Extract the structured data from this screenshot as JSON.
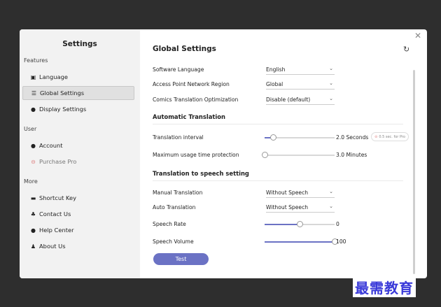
{
  "window": {
    "close_icon": "close-icon"
  },
  "sidebar": {
    "title": "Settings",
    "sections": [
      {
        "label": "Features",
        "items": [
          {
            "label": "Language",
            "icon": "language-icon"
          },
          {
            "label": "Global Settings",
            "icon": "sliders-icon",
            "active": true
          },
          {
            "label": "Display Settings",
            "icon": "palette-icon"
          }
        ]
      },
      {
        "label": "User",
        "items": [
          {
            "label": "Account",
            "icon": "user-icon"
          },
          {
            "label": "Purchase Pro",
            "icon": "pro-icon"
          }
        ]
      },
      {
        "label": "More",
        "items": [
          {
            "label": "Shortcut Key",
            "icon": "keyboard-icon"
          },
          {
            "label": "Contact Us",
            "icon": "contacts-icon"
          },
          {
            "label": "Help Center",
            "icon": "help-icon"
          },
          {
            "label": "About Us",
            "icon": "people-icon"
          }
        ]
      }
    ]
  },
  "main": {
    "title": "Global Settings",
    "refresh_icon": "refresh-icon",
    "general": {
      "software_language": {
        "label": "Software Language",
        "value": "English"
      },
      "access_point": {
        "label": "Access Point Network Region",
        "value": "Global"
      },
      "comics": {
        "label": "Comics Translation Optimization",
        "value": "Disable (default)"
      }
    },
    "auto_translation": {
      "title": "Automatic Translation",
      "interval": {
        "label": "Translation interval",
        "value_text": "2.0 Seconds",
        "level": 0.12,
        "pro_badge": "0.5 sec. for Pro"
      },
      "max_usage": {
        "label": "Maximum usage time protection",
        "value_text": "3.0 Minutes",
        "level": 0.0
      }
    },
    "speech": {
      "title": "Translation to speech setting",
      "manual": {
        "label": "Manual Translation",
        "value": "Without Speech"
      },
      "auto": {
        "label": "Auto Translation",
        "value": "Without Speech"
      },
      "rate": {
        "label": "Speech Rate",
        "value_text": "0",
        "level": 0.5
      },
      "volume": {
        "label": "Speech Volume",
        "value_text": "100",
        "level": 1.0
      }
    },
    "test_button": "Test"
  },
  "watermark": "最需教育",
  "colors": {
    "accent": "#6b72c4",
    "background": "#2e2e2e",
    "sidebar": "#f2f2f2"
  }
}
